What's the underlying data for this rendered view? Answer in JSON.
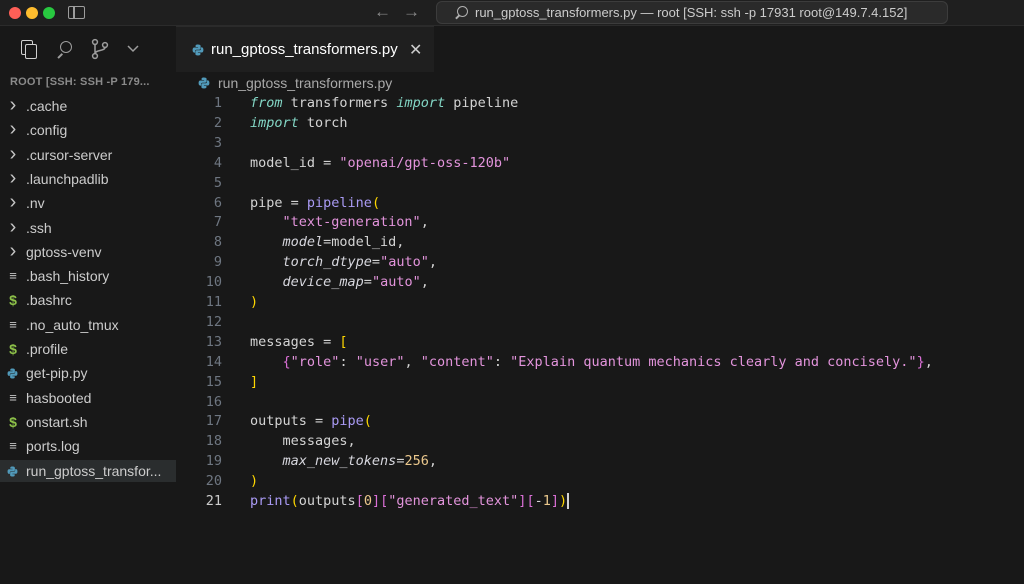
{
  "window": {
    "title": "run_gptoss_transformers.py — root [SSH: ssh -p 17931 root@149.7.4.152]"
  },
  "explorer": {
    "header": "ROOT [SSH: SSH -P 179...",
    "items": [
      {
        "label": ".cache",
        "icon": "chevron-right-icon"
      },
      {
        "label": ".config",
        "icon": "chevron-right-icon"
      },
      {
        "label": ".cursor-server",
        "icon": "chevron-right-icon"
      },
      {
        "label": ".launchpadlib",
        "icon": "chevron-right-icon"
      },
      {
        "label": ".nv",
        "icon": "chevron-right-icon"
      },
      {
        "label": ".ssh",
        "icon": "chevron-right-icon"
      },
      {
        "label": "gptoss-venv",
        "icon": "chevron-right-icon"
      },
      {
        "label": ".bash_history",
        "icon": "text-file-icon"
      },
      {
        "label": ".bashrc",
        "icon": "shell-file-icon"
      },
      {
        "label": ".no_auto_tmux",
        "icon": "text-file-icon"
      },
      {
        "label": ".profile",
        "icon": "shell-file-icon"
      },
      {
        "label": "get-pip.py",
        "icon": "python-file-icon"
      },
      {
        "label": "hasbooted",
        "icon": "text-file-icon"
      },
      {
        "label": "onstart.sh",
        "icon": "shell-file-icon"
      },
      {
        "label": "ports.log",
        "icon": "text-file-icon"
      },
      {
        "label": "run_gptoss_transfor...",
        "icon": "python-file-icon"
      }
    ]
  },
  "editor": {
    "tab_label": "run_gptoss_transformers.py",
    "breadcrumb": "run_gptoss_transformers.py",
    "current_line": 21,
    "line_numbers": [
      "1",
      "2",
      "3",
      "4",
      "5",
      "6",
      "7",
      "8",
      "9",
      "10",
      "11",
      "12",
      "13",
      "14",
      "15",
      "16",
      "17",
      "18",
      "19",
      "20",
      "21"
    ]
  },
  "colors": {
    "keyword": "#83d6c5",
    "string": "#e394dc",
    "call": "#aa9bf5",
    "number": "#ebc88d",
    "bracket": "#ffd700",
    "background": "#181818"
  }
}
